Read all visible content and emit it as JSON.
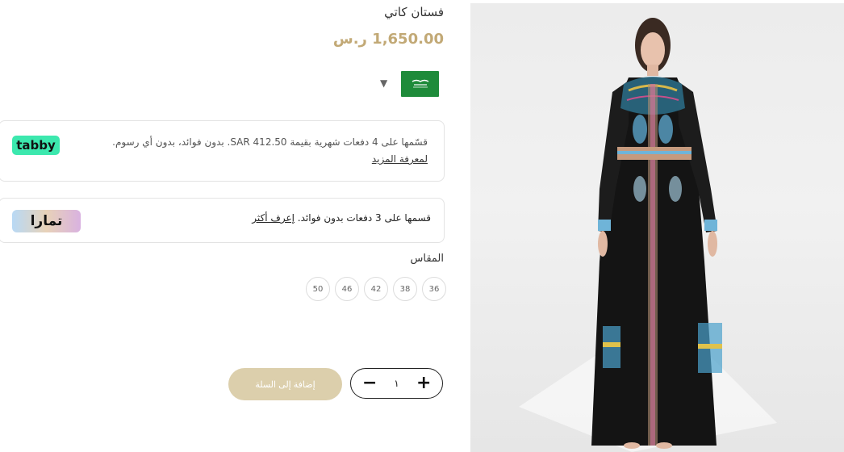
{
  "product": {
    "title": "فستان كاتي",
    "price": "1,650.00 ر.س"
  },
  "country": {
    "flag_icon": "saudi-flag-icon",
    "caret": "▼"
  },
  "tabby": {
    "logo": "tabby",
    "text": "قسّمها على 4 دفعات شهرية بقيمة SAR 412.50. بدون فوائد، بدون أي رسوم.",
    "more_link": "لمعرفة المزيد"
  },
  "tamara": {
    "logo": "تمارا",
    "text": "قسمها على 3 دفعات بدون فوائد.",
    "more_link": "إعرف أكثر"
  },
  "sizes": {
    "label": "المقاس",
    "options": [
      "36",
      "38",
      "42",
      "46",
      "50"
    ]
  },
  "cart": {
    "add_label": "إضافة إلى السلة",
    "quantity": "١",
    "plus": "+",
    "minus": "−"
  },
  "colors": {
    "accent": "#c2a976",
    "add_button": "#dccfac",
    "tabby_green": "#3ce8ae",
    "flag_green": "#1e8b3a"
  }
}
